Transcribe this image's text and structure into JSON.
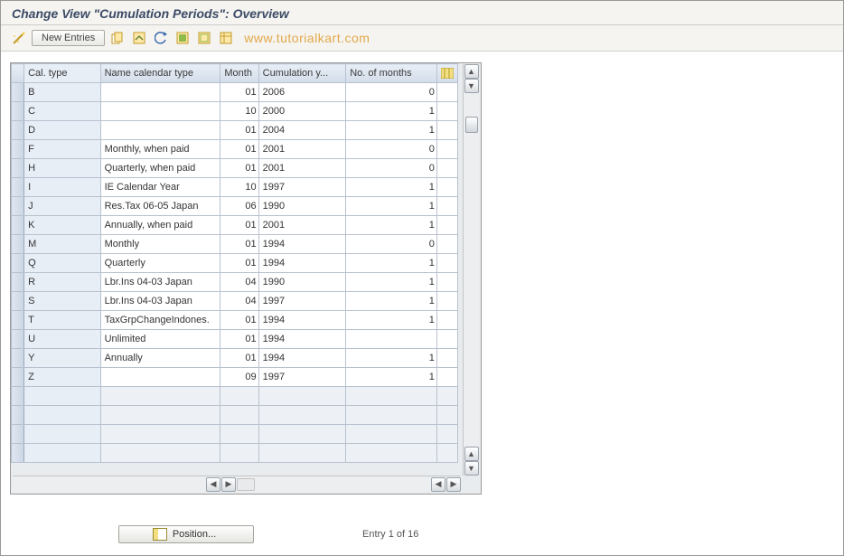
{
  "title": "Change View \"Cumulation Periods\": Overview",
  "toolbar": {
    "new_entries": "New Entries"
  },
  "watermark": "www.tutorialkart.com",
  "columns": {
    "caltype": "Cal. type",
    "name": "Name calendar type",
    "month": "Month",
    "year": "Cumulation y...",
    "months": "No. of months"
  },
  "rows": [
    {
      "caltype": "B",
      "name": "",
      "month": "01",
      "year": "2006",
      "months": "0"
    },
    {
      "caltype": "C",
      "name": "",
      "month": "10",
      "year": "2000",
      "months": "1"
    },
    {
      "caltype": "D",
      "name": "",
      "month": "01",
      "year": "2004",
      "months": "1"
    },
    {
      "caltype": "F",
      "name": "Monthly, when paid",
      "month": "01",
      "year": "2001",
      "months": "0"
    },
    {
      "caltype": "H",
      "name": "Quarterly, when paid",
      "month": "01",
      "year": "2001",
      "months": "0"
    },
    {
      "caltype": "I",
      "name": "IE Calendar Year",
      "month": "10",
      "year": "1997",
      "months": "1"
    },
    {
      "caltype": "J",
      "name": "Res.Tax 06-05  Japan",
      "month": "06",
      "year": "1990",
      "months": "1"
    },
    {
      "caltype": "K",
      "name": "Annually, when paid",
      "month": "01",
      "year": "2001",
      "months": "1"
    },
    {
      "caltype": "M",
      "name": "Monthly",
      "month": "01",
      "year": "1994",
      "months": "0"
    },
    {
      "caltype": "Q",
      "name": "Quarterly",
      "month": "01",
      "year": "1994",
      "months": "1"
    },
    {
      "caltype": "R",
      "name": "Lbr.Ins 04-03  Japan",
      "month": "04",
      "year": "1990",
      "months": "1"
    },
    {
      "caltype": "S",
      "name": "Lbr.Ins 04-03  Japan",
      "month": "04",
      "year": "1997",
      "months": "1"
    },
    {
      "caltype": "T",
      "name": "TaxGrpChangeIndones.",
      "month": "01",
      "year": "1994",
      "months": "1"
    },
    {
      "caltype": "U",
      "name": "Unlimited",
      "month": "01",
      "year": "1994",
      "months": ""
    },
    {
      "caltype": "Y",
      "name": "Annually",
      "month": "01",
      "year": "1994",
      "months": "1"
    },
    {
      "caltype": "Z",
      "name": "",
      "month": "09",
      "year": "1997",
      "months": "1"
    }
  ],
  "empty_rows": 4,
  "footer": {
    "position_label": "Position...",
    "entry_text": "Entry 1 of 16"
  },
  "colors": {
    "header_bg": "#e8eef6",
    "accent": "#3b4a66",
    "watermark": "#e2a84a"
  }
}
